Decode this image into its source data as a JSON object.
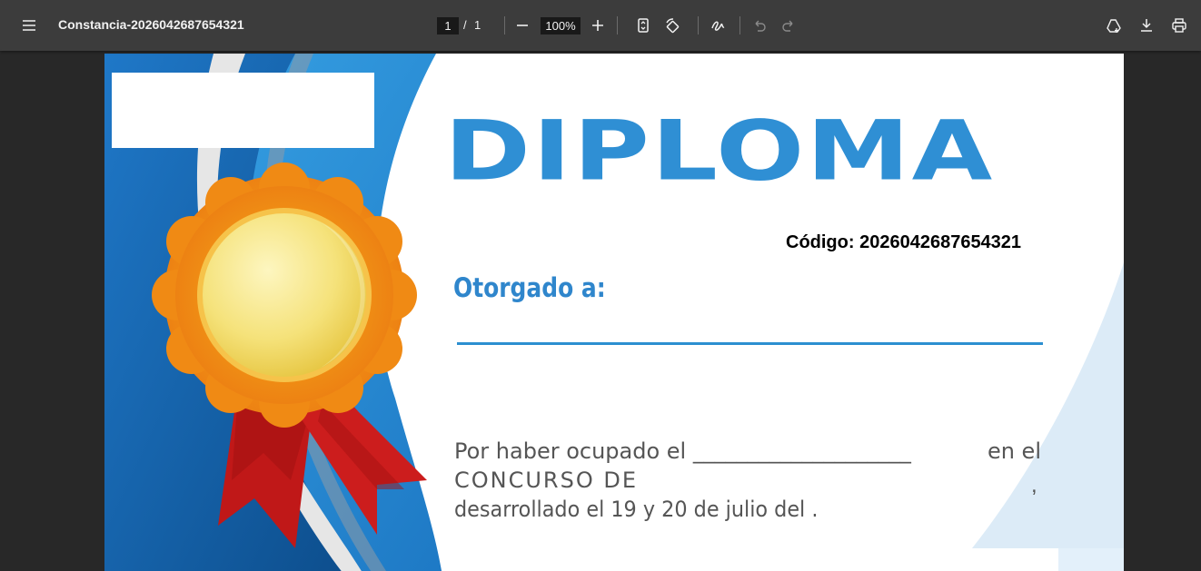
{
  "toolbar": {
    "menu_icon": "hamburger-menu-icon",
    "document_title": "Constancia-2026042687654321",
    "page_current": "1",
    "page_separator": "/",
    "page_total": "1",
    "zoom_level": "100%",
    "icons": [
      "minus-icon",
      "plus-icon",
      "fit-page-icon",
      "rotate-icon",
      "draw-icon",
      "undo-icon",
      "redo-icon",
      "drive-save-icon",
      "download-icon",
      "print-icon"
    ]
  },
  "certificate": {
    "title": "DIPLOMA",
    "code_label": "Código: 2026042687654321",
    "awarded_to": "Otorgado a:",
    "body_line1_left": "Por haber ocupado el ____________________",
    "body_line1_right": "en el",
    "body_line2": "CONCURSO DE",
    "body_comma": ",",
    "body_line3": "desarrollado el 19 y 20 de julio del        .",
    "colors": {
      "primary_blue": "#2f8fd4",
      "dark_blue": "#0d4f8a",
      "medal_gold": "#f2b51c",
      "ribbon_red": "#c01818"
    }
  }
}
